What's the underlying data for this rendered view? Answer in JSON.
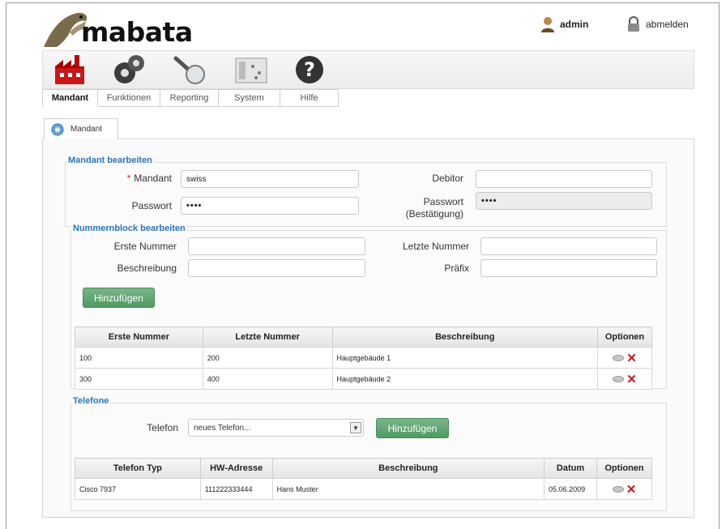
{
  "header": {
    "logo_text": "mabata",
    "user": "admin",
    "logout": "abmelden"
  },
  "nav": {
    "icons": [
      "factory-icon",
      "gears-icon",
      "magnifier-icon",
      "system-panel-icon",
      "help-icon"
    ],
    "tabs": [
      {
        "label": "Mandant",
        "active": true
      },
      {
        "label": "Funktionen",
        "active": false
      },
      {
        "label": "Reporting",
        "active": false
      },
      {
        "label": "System",
        "active": false
      },
      {
        "label": "Hilfe",
        "active": false
      }
    ]
  },
  "page_tab": {
    "label": "Mandant"
  },
  "mandant": {
    "legend": "Mandant bearbeiten",
    "mandant_label": "Mandant",
    "mandant_value": "swiss",
    "debitor_label": "Debitor",
    "debitor_value": "",
    "passwort_label": "Passwort",
    "passwort_value": "••••",
    "passwort_bestaetigung_label_1": "Passwort",
    "passwort_bestaetigung_label_2": "(Bestätigung)",
    "passwort_bestaetigung_value": "••••"
  },
  "nummernblock": {
    "legend": "Nummernblock bearbeiten",
    "erste_label": "Erste Nummer",
    "letzte_label": "Letzte Nummer",
    "beschreibung_label": "Beschreibung",
    "praefix_label": "Präfix",
    "add_button": "Hinzufügen",
    "columns": [
      "Erste Nummer",
      "Letzte Nummer",
      "Beschreibung",
      "Optionen"
    ],
    "rows": [
      {
        "erste": "100",
        "letzte": "200",
        "beschreibung": "Hauptgebäude 1"
      },
      {
        "erste": "300",
        "letzte": "400",
        "beschreibung": "Hauptgebäude 2"
      }
    ]
  },
  "telefone": {
    "legend": "Telefone",
    "telefon_label": "Telefon",
    "select_value": "neues Telefon...",
    "add_button": "Hinzufügen",
    "columns": [
      "Telefon Typ",
      "HW-Adresse",
      "Beschreibung",
      "Datum",
      "Optionen"
    ],
    "rows": [
      {
        "typ": "Cisco 7937",
        "hw": "111222333444",
        "beschreibung": "Hans Muster",
        "datum": "05.06.2009"
      }
    ]
  },
  "colors": {
    "legend_blue": "#2b74b8",
    "button_green": "#4f9a62",
    "delete_red": "#d0121b",
    "required_red": "#dd2222"
  }
}
